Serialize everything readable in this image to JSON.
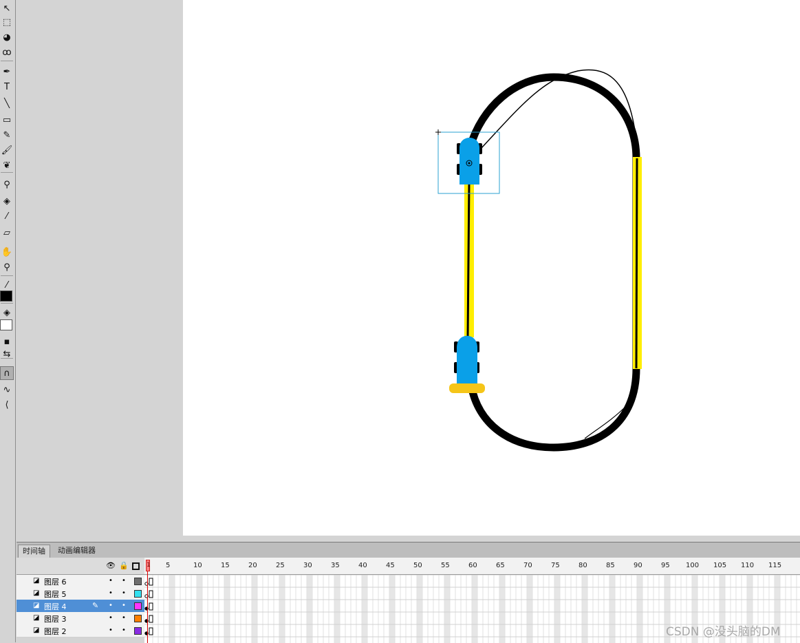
{
  "toolbar": {
    "tools": [
      {
        "id": "selection",
        "icon": "arrow-select-icon",
        "glyph": "↖"
      },
      {
        "id": "free-transform",
        "icon": "free-transform-icon",
        "glyph": "⬚"
      },
      {
        "id": "3d-rotation",
        "icon": "3d-rotation-icon",
        "glyph": "◕"
      },
      {
        "id": "lasso",
        "icon": "lasso-icon",
        "glyph": "ꝏ"
      },
      {
        "id": "pen",
        "icon": "pen-icon",
        "glyph": "✒"
      },
      {
        "id": "text",
        "icon": "text-tool-icon",
        "glyph": "T"
      },
      {
        "id": "line",
        "icon": "line-tool-icon",
        "glyph": "╲"
      },
      {
        "id": "rectangle",
        "icon": "rectangle-icon",
        "glyph": "▭"
      },
      {
        "id": "pencil",
        "icon": "pencil-icon",
        "glyph": "✎"
      },
      {
        "id": "brush",
        "icon": "brush-icon",
        "glyph": "🖌"
      },
      {
        "id": "deco",
        "icon": "deco-icon",
        "glyph": "❦"
      },
      {
        "id": "bone",
        "icon": "bone-icon",
        "glyph": "⚲"
      },
      {
        "id": "paint-bucket",
        "icon": "paint-bucket-icon",
        "glyph": "◈"
      },
      {
        "id": "eyedropper",
        "icon": "eyedropper-icon",
        "glyph": "⁄"
      },
      {
        "id": "eraser",
        "icon": "eraser-icon",
        "glyph": "▱"
      },
      {
        "id": "hand",
        "icon": "hand-icon",
        "glyph": "✋"
      },
      {
        "id": "zoom",
        "icon": "zoom-icon",
        "glyph": "⚲"
      }
    ],
    "stroke_color": "#000000",
    "fill_color": "#ffffff"
  },
  "timeline": {
    "tabs": [
      "时间轴",
      "动画编辑器"
    ],
    "active_tab": 0,
    "current_frame": "1",
    "frame_numbers": [
      "5",
      "10",
      "15",
      "20",
      "25",
      "30",
      "35",
      "40",
      "45",
      "50",
      "55",
      "60",
      "65",
      "70",
      "75",
      "80",
      "85",
      "90",
      "95",
      "100",
      "105",
      "110",
      "115"
    ],
    "layers": [
      {
        "name": "图层 6",
        "color": "#6e6e6e",
        "selected": false
      },
      {
        "name": "图层 5",
        "color": "#33e0f0",
        "selected": false
      },
      {
        "name": "图层 4",
        "color": "#ff33ff",
        "selected": true
      },
      {
        "name": "图层 3",
        "color": "#ff7f00",
        "selected": false
      },
      {
        "name": "图层 2",
        "color": "#8a2be2",
        "selected": false
      }
    ]
  },
  "watermark": "CSDN @没头脑的DM",
  "colors": {
    "track": "#000000",
    "rail": "#ffee00",
    "car": "#0aa0e8",
    "car_base": "#f5c518",
    "selection_box": "#2aa0d0"
  }
}
